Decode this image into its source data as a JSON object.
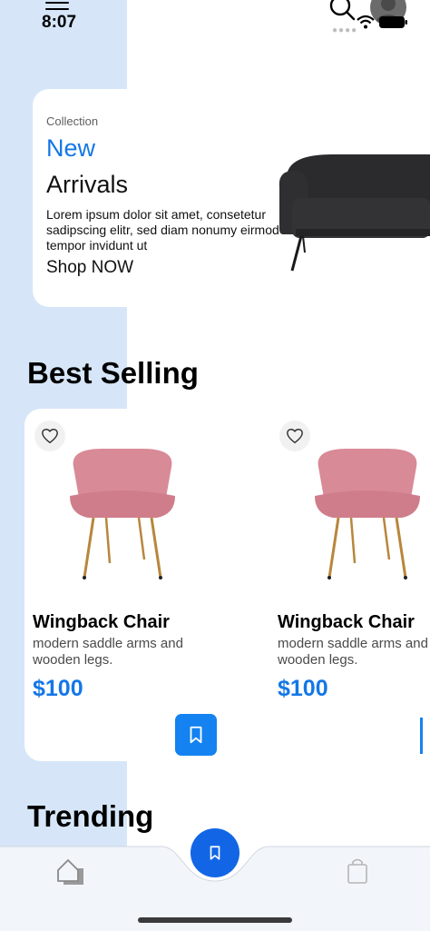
{
  "status_bar": {
    "time": "8:07"
  },
  "hero": {
    "eyebrow": "Collection",
    "title_highlight": "New",
    "title": "Arrivals",
    "description_lines": [
      "Lorem ipsum dolor sit amet, consetetur",
      "sadipscing elitr, sed diam nonumy eirmod",
      "tempor invidunt ut"
    ],
    "cta": "Shop NOW"
  },
  "sections": {
    "best_selling": "Best Selling",
    "trending": "Trending"
  },
  "products": [
    {
      "name": "Wingback Chair",
      "description": "modern saddle arms and wooden legs.",
      "price": "$100"
    },
    {
      "name": "Wingback Chair",
      "description": "modern saddle arms and wooden legs.",
      "price": "$100"
    }
  ],
  "colors": {
    "accent": "#1477e6",
    "side_band": "#d6e6f8",
    "chair_pink": "#d98a97",
    "fab": "#1266e6"
  },
  "icons": {
    "menu": "menu-icon",
    "search": "search-icon",
    "favorite": "heart-icon",
    "save": "bookmark-icon",
    "home": "home-icon",
    "bag": "shopping-bag-icon"
  }
}
